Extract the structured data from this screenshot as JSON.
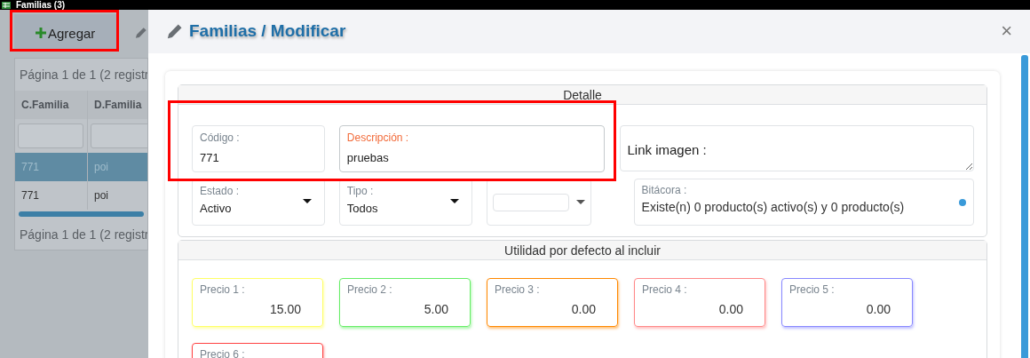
{
  "window": {
    "title": "Familias (3)"
  },
  "toolbar": {
    "add_button": "Agregar"
  },
  "grid": {
    "pager_top": "Página 1 de 1 (2 registr",
    "columns": [
      "C.Familia",
      "D.Familia"
    ],
    "rows": [
      {
        "cells": [
          "771",
          "poi"
        ],
        "selected": true
      },
      {
        "cells": [
          "771",
          "poi"
        ],
        "selected": false
      }
    ],
    "pager_bottom": "Página 1 de 1 (2 registr"
  },
  "dialog": {
    "title": "Familias / Modificar",
    "close": "×",
    "detalle": {
      "title": "Detalle",
      "codigo": {
        "label": "Código :",
        "value": "771",
        "focused": false
      },
      "descripcion": {
        "label": "Descripción :",
        "value": "pruebas",
        "focused": true
      },
      "link_imagen": {
        "placeholder": "Link imagen :"
      },
      "estado": {
        "label": "Estado :",
        "value": "Activo"
      },
      "tipo": {
        "label": "Tipo :",
        "value": "Todos"
      },
      "bitacora": {
        "label": "Bitácora :",
        "value": "Existe(n) 0 producto(s) activo(s) y 0 producto(s)"
      }
    },
    "utilidad": {
      "title": "Utilidad por defecto al incluir",
      "precios": [
        {
          "label": "Precio 1 :",
          "value": "15.00",
          "color": "#ffff66"
        },
        {
          "label": "Precio 2 :",
          "value": "5.00",
          "color": "#66ee66"
        },
        {
          "label": "Precio 3 :",
          "value": "0.00",
          "color": "#ff8800"
        },
        {
          "label": "Precio 4 :",
          "value": "0.00",
          "color": "#ff8888"
        },
        {
          "label": "Precio 5 :",
          "value": "0.00",
          "color": "#8888ff"
        },
        {
          "label": "Precio 6 :",
          "color": "#ff4444"
        }
      ]
    }
  }
}
